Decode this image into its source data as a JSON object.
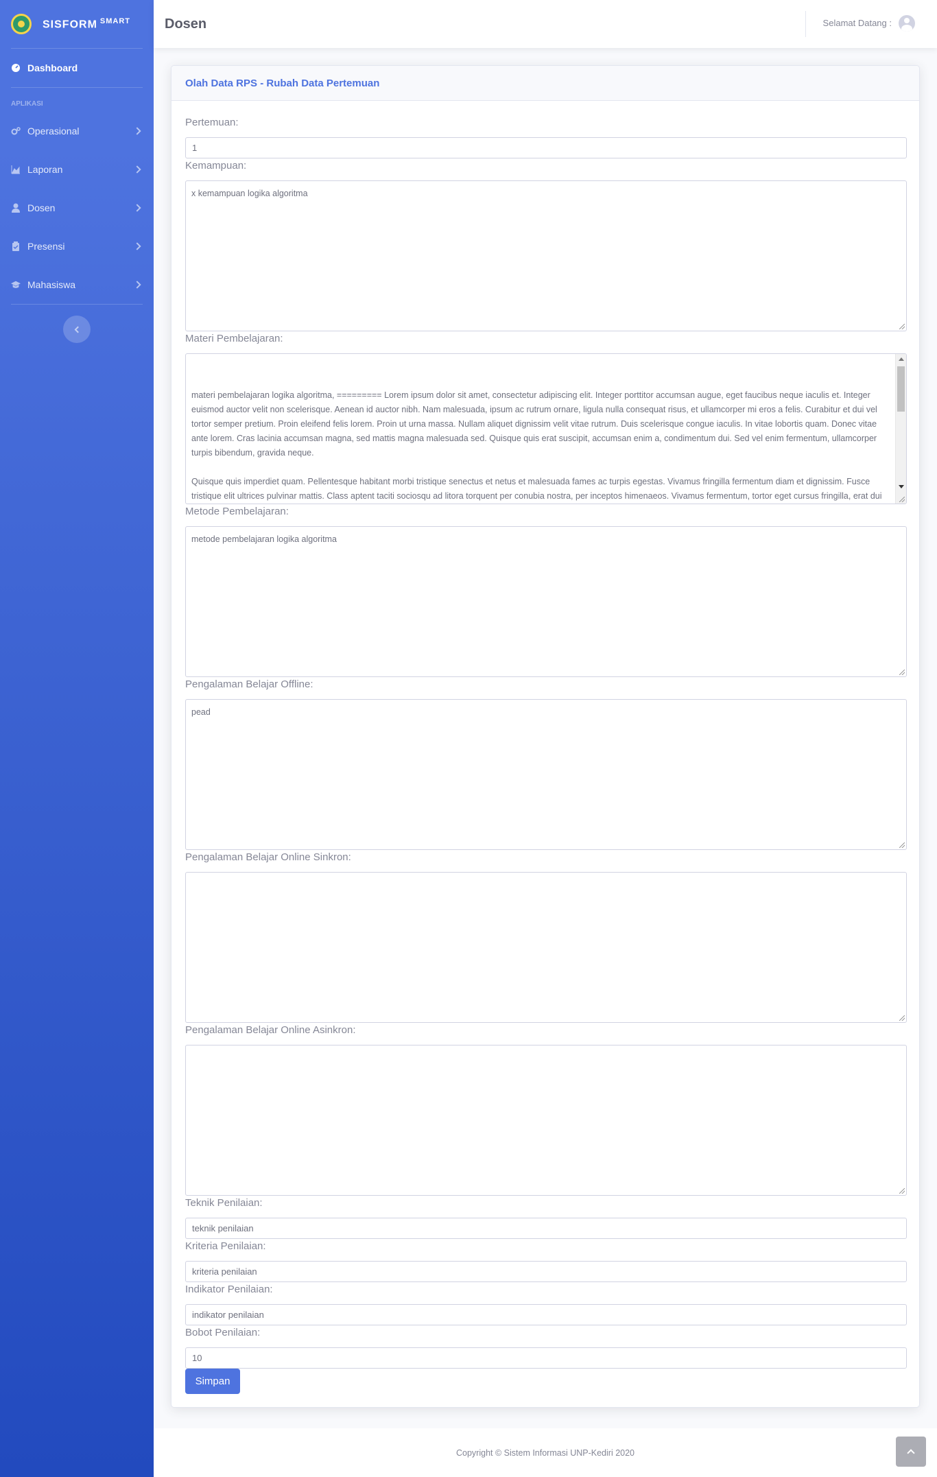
{
  "brand": {
    "name": "SISFORM",
    "sup": "SMART"
  },
  "sidebar": {
    "dashboard": "Dashboard",
    "heading": "APLIKASI",
    "items": [
      {
        "label": "Operasional",
        "icon": "cogs-icon"
      },
      {
        "label": "Laporan",
        "icon": "chart-area-icon"
      },
      {
        "label": "Dosen",
        "icon": "user-icon"
      },
      {
        "label": "Presensi",
        "icon": "clipboard-icon"
      },
      {
        "label": "Mahasiswa",
        "icon": "graduation-cap-icon"
      }
    ]
  },
  "topbar": {
    "title": "Dosen",
    "welcome": "Selamat Datang :"
  },
  "card": {
    "title": "Olah Data RPS - Rubah Data Pertemuan"
  },
  "form": {
    "pertemuan": {
      "label": "Pertemuan:",
      "value": "1"
    },
    "kemampuan": {
      "label": "Kemampuan:",
      "value": "x kemampuan logika algoritma"
    },
    "materi": {
      "label": "Materi Pembelajaran:",
      "value": "materi pembelajaran logika algoritma, ========= Lorem ipsum dolor sit amet, consectetur adipiscing elit. Integer porttitor accumsan augue, eget faucibus neque iaculis et. Integer euismod auctor velit non scelerisque. Aenean id auctor nibh. Nam malesuada, ipsum ac rutrum ornare, ligula nulla consequat risus, et ullamcorper mi eros a felis. Curabitur et dui vel tortor semper pretium. Proin eleifend felis lorem. Proin ut urna massa. Nullam aliquet dignissim velit vitae rutrum. Duis scelerisque congue iaculis. In vitae lobortis quam. Donec vitae ante lorem. Cras lacinia accumsan magna, sed mattis magna malesuada sed. Quisque quis erat suscipit, accumsan enim a, condimentum dui. Sed vel enim fermentum, ullamcorper turpis bibendum, gravida neque.\n\nQuisque quis imperdiet quam. Pellentesque habitant morbi tristique senectus et netus et malesuada fames ac turpis egestas. Vivamus fringilla fermentum diam et dignissim. Fusce tristique elit ultrices pulvinar mattis. Class aptent taciti sociosqu ad litora torquent per conubia nostra, per inceptos himenaeos. Vivamus fermentum, tortor eget cursus fringilla, erat dui porttitor libero, eu semper nisl dui vitae tellus. Vivamus sed placerat mauris, sed rutrum nunc. Nam nec feugiat justo. Duis scelerisque fringilla aliquet."
    },
    "metode": {
      "label": "Metode Pembelajaran:",
      "value": "metode pembelajaran logika algoritma"
    },
    "offline": {
      "label": "Pengalaman Belajar Offline:",
      "value": "pead"
    },
    "sinkron": {
      "label": "Pengalaman Belajar Online Sinkron:",
      "value": ""
    },
    "asinkron": {
      "label": "Pengalaman Belajar Online Asinkron:",
      "value": ""
    },
    "teknik": {
      "label": "Teknik Penilaian:",
      "value": "teknik penilaian"
    },
    "kriteria": {
      "label": "Kriteria Penilaian:",
      "value": "kriteria penilaian"
    },
    "indikator": {
      "label": "Indikator Penilaian:",
      "value": "indikator penilaian"
    },
    "bobot": {
      "label": "Bobot Penilaian:",
      "value": "10"
    },
    "submit": "Simpan"
  },
  "footer": {
    "copyright": "Copyright © Sistem Informasi UNP-Kediri 2020"
  },
  "colors": {
    "primary": "#4e73df",
    "sidebar_end": "#224abe"
  }
}
